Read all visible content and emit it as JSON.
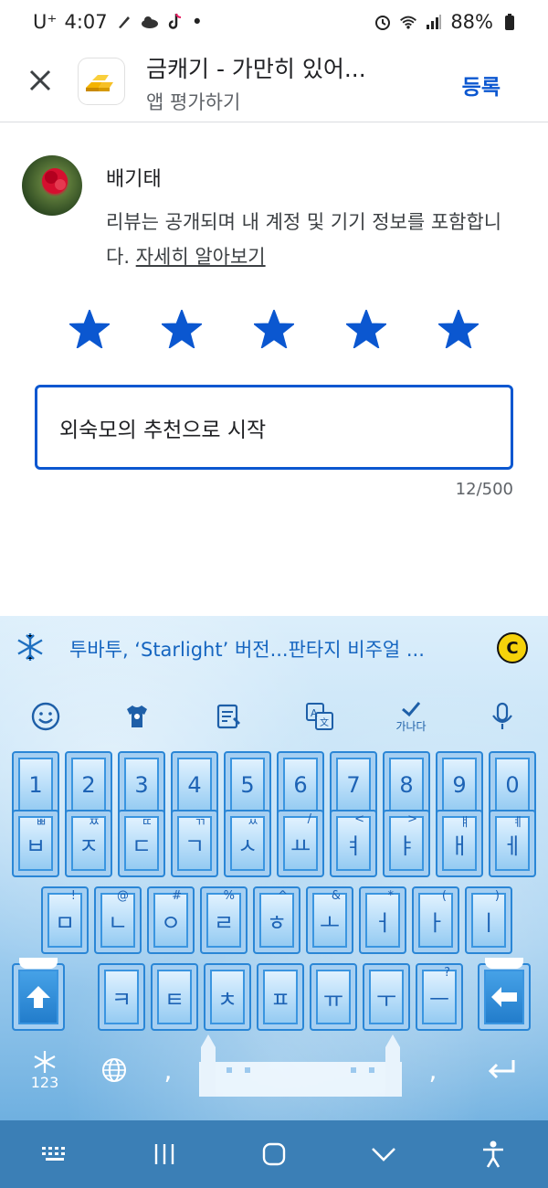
{
  "status_bar": {
    "carrier": "U⁺",
    "time": "4:07",
    "dot": "•",
    "battery": "88%"
  },
  "header": {
    "app_title": "금캐기 - 가만히 있어...",
    "subtitle": "앱 평가하기",
    "submit_label": "등록"
  },
  "review": {
    "reviewer_name": "배기태",
    "notice_text": "리뷰는 공개되며 내 계정 및 기기 정보를 포함합니다.",
    "learn_more": "자세히 알아보기",
    "rating": 5,
    "max_rating": 5,
    "text_value": "외숙모의 추천으로 시작",
    "char_count": "12/500"
  },
  "keyboard": {
    "suggestion": "투바투, ‘Starlight’ 버전...판타지 비주얼 ...",
    "coin_label": "C",
    "spell_label": "가나다",
    "number_row": [
      "1",
      "2",
      "3",
      "4",
      "5",
      "6",
      "7",
      "8",
      "9",
      "0"
    ],
    "row1": [
      {
        "k": "ㅂ",
        "s": "ㅃ"
      },
      {
        "k": "ㅈ",
        "s": "ㅉ"
      },
      {
        "k": "ㄷ",
        "s": "ㄸ"
      },
      {
        "k": "ㄱ",
        "s": "ㄲ"
      },
      {
        "k": "ㅅ",
        "s": "ㅆ"
      },
      {
        "k": "ㅛ",
        "s": "/"
      },
      {
        "k": "ㅕ",
        "s": "<"
      },
      {
        "k": "ㅑ",
        "s": ">"
      },
      {
        "k": "ㅐ",
        "s": "ㅒ"
      },
      {
        "k": "ㅔ",
        "s": "ㅖ"
      }
    ],
    "row2": [
      {
        "k": "ㅁ",
        "s": "!"
      },
      {
        "k": "ㄴ",
        "s": "@"
      },
      {
        "k": "ㅇ",
        "s": "#"
      },
      {
        "k": "ㄹ",
        "s": "%"
      },
      {
        "k": "ㅎ",
        "s": "^"
      },
      {
        "k": "ㅗ",
        "s": "&"
      },
      {
        "k": "ㅓ",
        "s": "*"
      },
      {
        "k": "ㅏ",
        "s": "("
      },
      {
        "k": "ㅣ",
        "s": ")"
      }
    ],
    "row3": [
      {
        "k": "ㅋ",
        "s": ""
      },
      {
        "k": "ㅌ",
        "s": ""
      },
      {
        "k": "ㅊ",
        "s": ""
      },
      {
        "k": "ㅍ",
        "s": ""
      },
      {
        "k": "ㅠ",
        "s": ""
      },
      {
        "k": "ㅜ",
        "s": ""
      },
      {
        "k": "ㅡ",
        "s": "?"
      }
    ],
    "symbols_label": "123",
    "comma_left": ",",
    "comma_right": ","
  },
  "colors": {
    "accent": "#0b57d0",
    "star": "#0b57d0",
    "navbar": "#3b7fb6"
  }
}
